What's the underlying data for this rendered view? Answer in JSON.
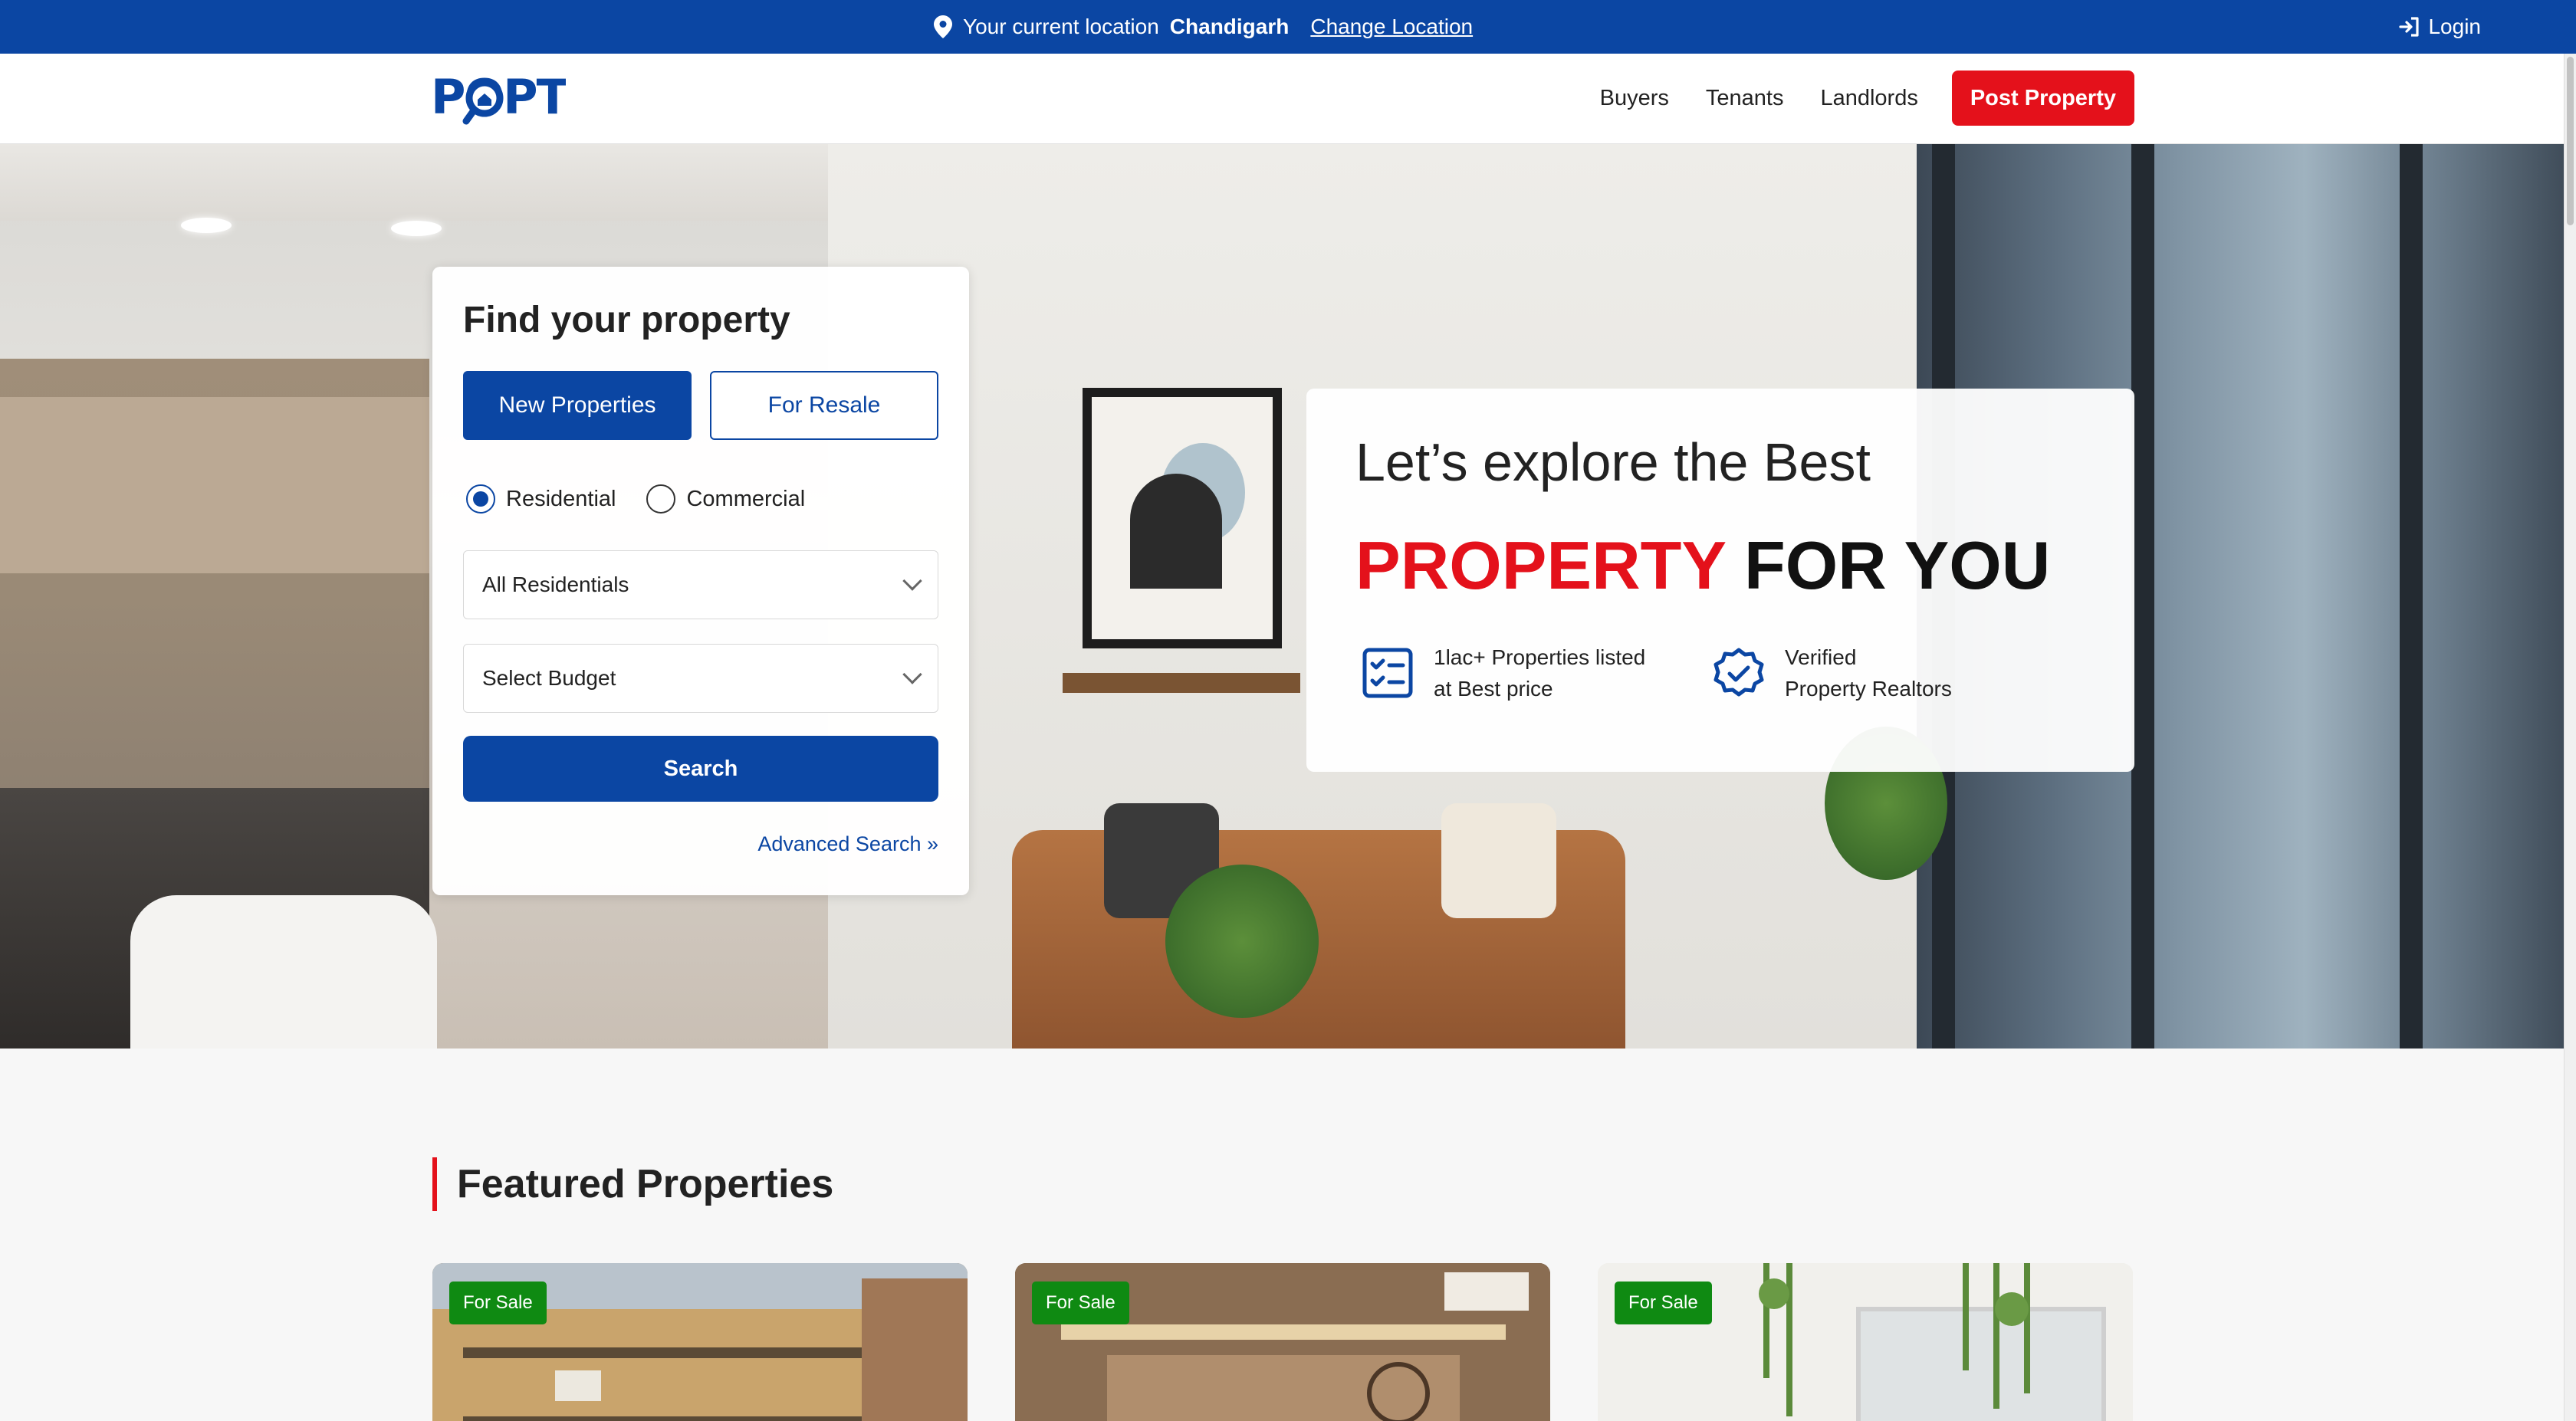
{
  "topbar": {
    "location_prefix": "Your current location",
    "city": "Chandigarh",
    "change_label": "Change Location",
    "login_label": "Login"
  },
  "header": {
    "logo_text": "POPT",
    "nav": [
      {
        "label": "Buyers"
      },
      {
        "label": "Tenants"
      },
      {
        "label": "Landlords"
      }
    ],
    "post_button": "Post Property"
  },
  "search": {
    "title": "Find your property",
    "tabs": [
      {
        "label": "New Properties",
        "active": true
      },
      {
        "label": "For Resale",
        "active": false
      }
    ],
    "radios": [
      {
        "label": "Residential",
        "checked": true
      },
      {
        "label": "Commercial",
        "checked": false
      }
    ],
    "type_select": "All Residentials",
    "budget_select": "Select Budget",
    "search_button": "Search",
    "advanced_link": "Advanced Search »"
  },
  "promo": {
    "line1": "Let’s explore the Best",
    "line2_red": "PROPERTY",
    "line2_dark": "FOR YOU",
    "features": [
      {
        "icon": "checklist-icon",
        "line1": "1lac+ Properties listed",
        "line2": "at Best price"
      },
      {
        "icon": "verified-badge-icon",
        "line1": "Verified",
        "line2": "Property Realtors"
      }
    ]
  },
  "featured": {
    "title": "Featured Properties",
    "cards": [
      {
        "badge": "For Sale"
      },
      {
        "badge": "For Sale"
      },
      {
        "badge": "For Sale"
      }
    ]
  },
  "colors": {
    "brand_blue": "#0b46a3",
    "accent_red": "#e4111b",
    "badge_green": "#0f8a12"
  }
}
